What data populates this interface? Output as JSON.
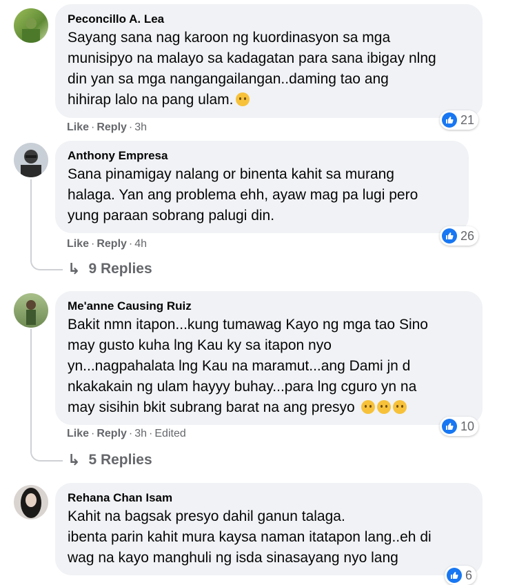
{
  "comments": [
    {
      "name": "Peconcillo A. Lea",
      "text": "Sayang sana nag karoon ng kuordinasyon sa mga\nmunisipyo na malayo sa kadagatan para sana ibigay nlng\ndin yan sa mga nangangailangan..daming tao ang\nhihirap lalo na pang ulam.",
      "like": "Like",
      "reply": "Reply",
      "time": "3h",
      "reactions": "21"
    },
    {
      "name": "Anthony Empresa",
      "text": "Sana pinamigay nalang or binenta kahit sa murang\nhalaga. Yan ang problema ehh, ayaw mag pa lugi pero\nyung paraan sobrang palugi din.",
      "like": "Like",
      "reply": "Reply",
      "time": "4h",
      "reactions": "26",
      "replies": "9 Replies"
    },
    {
      "name": "Me'anne Causing Ruiz",
      "text": "Bakit nmn itapon...kung tumawag Kayo ng mga tao Sino\nmay gusto kuha lng Kau ky sa itapon nyo\nyn...nagpahalata lng Kau na maramut...ang Dami jn d\nnkakakain ng ulam hayyy buhay...para lng cguro yn na\nmay sisihin bkit subrang barat na ang presyo",
      "like": "Like",
      "reply": "Reply",
      "time": "3h",
      "edited": "Edited",
      "reactions": "10",
      "replies": "5 Replies"
    },
    {
      "name": "Rehana Chan Isam",
      "text": "Kahit na bagsak presyo dahil ganun talaga.\nibenta parin kahit mura kaysa naman itatapon lang..eh di\nwag na kayo manghuli ng isda sinasayang nyo lang",
      "reactions": "6"
    }
  ],
  "colors": {
    "bubble": "#f0f2f5",
    "meta": "#65676b",
    "like_blue": "#1877f2"
  }
}
